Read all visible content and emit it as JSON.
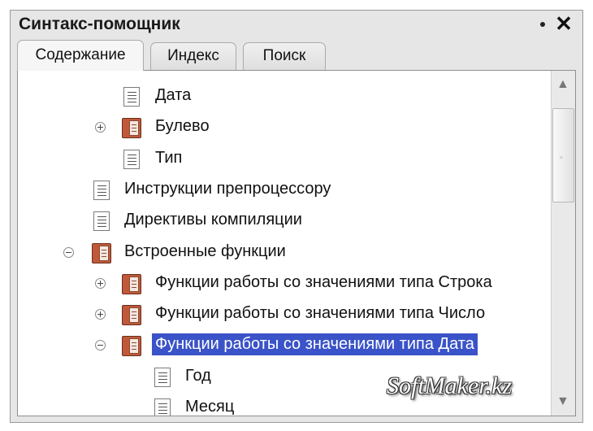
{
  "window": {
    "title": "Синтакс-помощник",
    "close_label": "✕"
  },
  "tabs": [
    {
      "label": "Содержание",
      "active": true
    },
    {
      "label": "Индекс",
      "active": false
    },
    {
      "label": "Поиск",
      "active": false
    }
  ],
  "tree": [
    {
      "label": "Дата",
      "icon": "page-icon",
      "level": 2,
      "toggle": null
    },
    {
      "label": "Булево",
      "icon": "book-icon",
      "level": 2,
      "toggle": "plus"
    },
    {
      "label": "Тип",
      "icon": "page-icon",
      "level": 2,
      "toggle": null
    },
    {
      "label": "Инструкции препроцессору",
      "icon": "page-icon",
      "level": 1,
      "toggle": null
    },
    {
      "label": "Директивы компиляции",
      "icon": "page-icon",
      "level": 1,
      "toggle": null
    },
    {
      "label": "Встроенные функции",
      "icon": "book-icon",
      "level": 1,
      "toggle": "minus"
    },
    {
      "label": "Функции работы со значениями типа Строка",
      "icon": "book-icon",
      "level": 2,
      "toggle": "plus"
    },
    {
      "label": "Функции работы со значениями типа Число",
      "icon": "book-icon",
      "level": 2,
      "toggle": "plus"
    },
    {
      "label": "Функции работы со значениями типа Дата",
      "icon": "book-icon",
      "level": 2,
      "toggle": "minus",
      "selected": true
    },
    {
      "label": "Год",
      "icon": "page-icon",
      "level": 3,
      "toggle": null
    },
    {
      "label": "Месяц",
      "icon": "page-icon",
      "level": 3,
      "toggle": null
    }
  ],
  "scrollbar": {
    "up_icon": "▲",
    "down_icon": "▼",
    "grip": "▫"
  },
  "watermark": "SoftMaker.kz"
}
